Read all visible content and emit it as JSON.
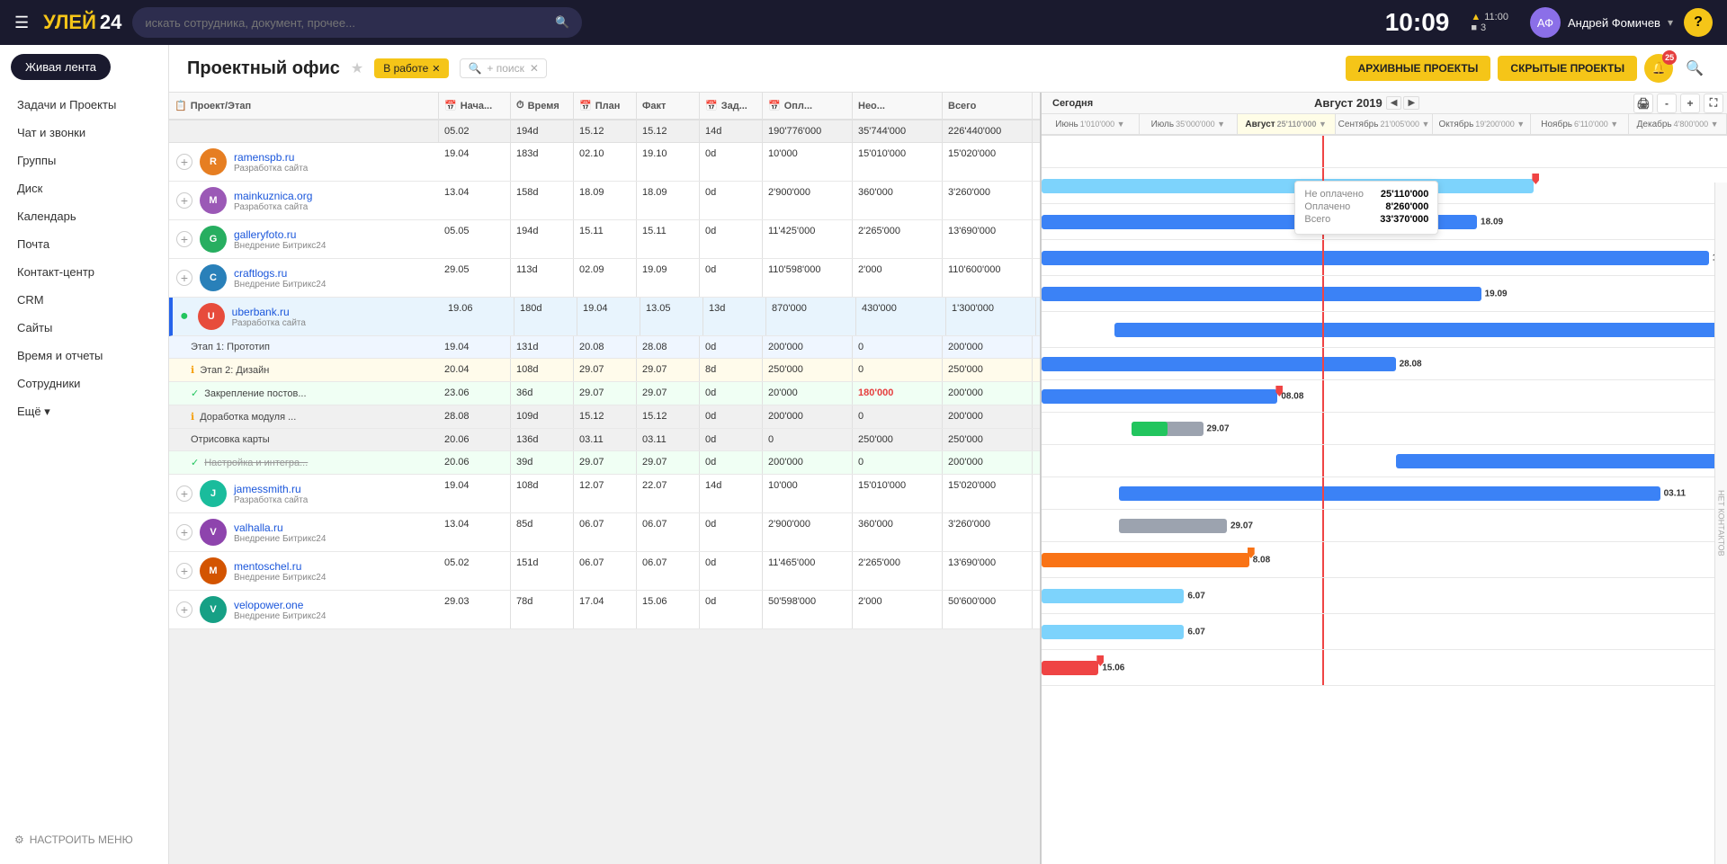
{
  "app": {
    "logo": "УЛЕЙ",
    "logo_number": "24",
    "search_placeholder": "искать сотрудника, документ, прочее...",
    "time": "10:09",
    "notification1": "▲ 11:00",
    "notification2": "■ 3",
    "user_name": "Андрей Фомичев",
    "help_label": "?"
  },
  "sidebar": {
    "live_feed": "Живая лента",
    "items": [
      {
        "label": "Задачи и Проекты",
        "active": false
      },
      {
        "label": "Чат и звонки",
        "active": false
      },
      {
        "label": "Группы",
        "active": false
      },
      {
        "label": "Диск",
        "active": false
      },
      {
        "label": "Календарь",
        "active": false
      },
      {
        "label": "Почта",
        "active": false
      },
      {
        "label": "Контакт-центр",
        "active": false
      },
      {
        "label": "CRM",
        "active": false
      },
      {
        "label": "Сайты",
        "active": false
      },
      {
        "label": "Время и отчеты",
        "active": false
      },
      {
        "label": "Сотрудники",
        "active": false
      },
      {
        "label": "Ещё ▾",
        "active": false
      }
    ],
    "settings_label": "НАСТРОИТЬ МЕНЮ"
  },
  "header": {
    "title": "Проектный офис",
    "filter_label": "В работе",
    "search_placeholder": "+ поиск",
    "archive_btn": "АРХИВНЫЕ ПРОЕКТЫ",
    "hidden_btn": "СКРЫТЫЕ ПРОЕКТЫ",
    "notif_count": "25"
  },
  "table": {
    "columns": [
      "Проект/Этап",
      "Нача...",
      "Время",
      "План",
      "Факт",
      "Зад...",
      "Опл...",
      "Нео...",
      "Всего"
    ],
    "summary": {
      "start": "05.02",
      "time": "194d",
      "plan": "15.12",
      "fact": "15.12",
      "tasks": "14d",
      "paid": "190'776'000",
      "unpaid": "35'744'000",
      "total": "226'440'000"
    },
    "projects": [
      {
        "name": "ramenspb.ru",
        "type": "Разработка сайта",
        "start": "19.04",
        "time": "183d",
        "plan": "02.10",
        "fact": "19.10",
        "tasks": "0d",
        "paid": "10'000",
        "unpaid": "15'010'000",
        "total": "15'020'000",
        "color": "#e67e22",
        "initials": "R"
      },
      {
        "name": "mainkuznica.org",
        "type": "Разработка сайта",
        "start": "13.04",
        "time": "158d",
        "plan": "18.09",
        "fact": "18.09",
        "tasks": "0d",
        "paid": "2'900'000",
        "unpaid": "360'000",
        "total": "3'260'000",
        "color": "#9b59b6",
        "initials": "M"
      },
      {
        "name": "galleryfoto.ru",
        "type": "Внедрение Битрикс24",
        "start": "05.05",
        "time": "194d",
        "plan": "15.11",
        "fact": "15.11",
        "tasks": "0d",
        "paid": "11'425'000",
        "unpaid": "2'265'000",
        "total": "13'690'000",
        "color": "#27ae60",
        "initials": "G"
      },
      {
        "name": "craftlogs.ru",
        "type": "Внедрение Битрикс24",
        "start": "29.05",
        "time": "113d",
        "plan": "02.09",
        "fact": "19.09",
        "tasks": "0d",
        "paid": "110'598'000",
        "unpaid": "2'000",
        "total": "110'600'000",
        "color": "#2980b9",
        "initials": "C"
      },
      {
        "name": "uberbank.ru",
        "type": "Разработка сайта",
        "start": "19.06",
        "time": "180d",
        "plan": "19.04",
        "fact": "13.05",
        "tasks": "13d",
        "paid": "870'000",
        "unpaid": "430'000",
        "total": "1'300'000",
        "color": "#e74c3c",
        "initials": "U",
        "active": true,
        "stages": [
          {
            "name": "Этап 1: Прототип",
            "start": "19.04",
            "time": "131d",
            "plan": "20.08",
            "fact": "28.08",
            "tasks": "0d",
            "paid": "200'000",
            "unpaid": "0",
            "total": "200'000",
            "bg": "blue"
          },
          {
            "name": "Этап 2: Дизайн",
            "start": "20.04",
            "time": "108d",
            "plan": "29.07",
            "fact": "29.07",
            "tasks": "8d",
            "paid": "250'000",
            "unpaid": "0",
            "total": "250'000",
            "bg": "yellow",
            "icon": "warning"
          },
          {
            "name": "Закрепление постов...",
            "start": "23.06",
            "time": "36d",
            "plan": "29.07",
            "fact": "29.07",
            "tasks": "0d",
            "paid": "20'000",
            "unpaid": "180'000",
            "total": "200'000",
            "bg": "green",
            "icon": "check",
            "strikethrough": false,
            "overdue_unpaid": true
          },
          {
            "name": "Доработка модуля ...",
            "start": "28.08",
            "time": "109d",
            "plan": "15.12",
            "fact": "15.12",
            "tasks": "0d",
            "paid": "200'000",
            "unpaid": "0",
            "total": "200'000",
            "bg": "white",
            "icon": "warning"
          },
          {
            "name": "Отрисовка карты",
            "start": "20.06",
            "time": "136d",
            "plan": "03.11",
            "fact": "03.11",
            "tasks": "0d",
            "paid": "0",
            "unpaid": "250'000",
            "total": "250'000",
            "bg": "white"
          },
          {
            "name": "Настройка и интегра...",
            "start": "20.06",
            "time": "39d",
            "plan": "29.07",
            "fact": "29.07",
            "tasks": "0d",
            "paid": "200'000",
            "unpaid": "0",
            "total": "200'000",
            "bg": "green",
            "icon": "check",
            "strikethrough": true
          }
        ]
      },
      {
        "name": "jamessmith.ru",
        "type": "Разработка сайта",
        "start": "19.04",
        "time": "108d",
        "plan": "12.07",
        "fact": "22.07",
        "tasks": "14d",
        "paid": "10'000",
        "unpaid": "15'010'000",
        "total": "15'020'000",
        "color": "#1abc9c",
        "initials": "J"
      },
      {
        "name": "valhalla.ru",
        "type": "Внедрение Битрикс24",
        "start": "13.04",
        "time": "85d",
        "plan": "06.07",
        "fact": "06.07",
        "tasks": "0d",
        "paid": "2'900'000",
        "unpaid": "360'000",
        "total": "3'260'000",
        "color": "#8e44ad",
        "initials": "V"
      },
      {
        "name": "mentoschel.ru",
        "type": "Внедрение Битрикс24",
        "start": "05.02",
        "time": "151d",
        "plan": "06.07",
        "fact": "06.07",
        "tasks": "0d",
        "paid": "11'465'000",
        "unpaid": "2'265'000",
        "total": "13'690'000",
        "color": "#d35400",
        "initials": "M"
      },
      {
        "name": "velopower.one",
        "type": "Внедрение Битрикс24",
        "start": "29.03",
        "time": "78d",
        "plan": "17.04",
        "fact": "15.06",
        "tasks": "0d",
        "paid": "50'598'000",
        "unpaid": "2'000",
        "total": "50'600'000",
        "color": "#16a085",
        "initials": "V"
      }
    ]
  },
  "gantt": {
    "period_label": "Август 2019",
    "today_label": "Сегодня",
    "months": [
      "Июнь",
      "Июль",
      "Август",
      "Сентябрь",
      "Октябрь",
      "Ноябрь",
      "Декабрь"
    ],
    "month_values": [
      "1'010'000 ▼",
      "35'000'000 ▼",
      "25'110'000 ▼",
      "21'005'000 ▼",
      "19'200'000 ▼",
      "6'110'000 ▼",
      "4'800'000 ▼"
    ],
    "tooltip": {
      "not_paid_label": "Не оплачено",
      "not_paid_value": "25'110'000",
      "paid_label": "Оплачено",
      "paid_value": "8'260'000",
      "total_label": "Всего",
      "total_value": "33'370'000"
    },
    "side_label": "НЕТ КОНТАКТОВ"
  }
}
